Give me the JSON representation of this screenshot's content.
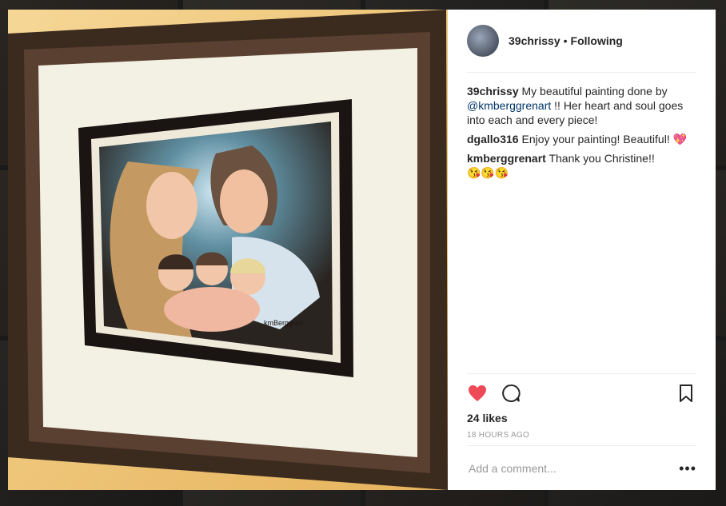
{
  "post": {
    "username": "39chrissy",
    "separator": "•",
    "follow_status": "Following",
    "caption": {
      "user": "39chrissy",
      "text_before": "My beautiful painting done by ",
      "mention": "@kmberggrenart",
      "text_after": " !! Her heart and soul goes into each and every piece!"
    },
    "comments": [
      {
        "user": "dgallo316",
        "text": "Enjoy your painting! Beautiful! ",
        "emoji": "💖"
      },
      {
        "user": "kmberggrenart",
        "text": "Thank you Christine!!",
        "emoji": "😘😘😘"
      }
    ],
    "likes": "24 likes",
    "timestamp": "18 HOURS AGO",
    "add_comment_placeholder": "Add a comment...",
    "more_label": "•••"
  },
  "photo": {
    "signature": "kmBerggren",
    "description_alt": "Framed painting"
  },
  "colors": {
    "heart": "#ed4956",
    "frame": "#3b2a1e",
    "mat": "#f3f0e4",
    "wall": "#f1c879"
  },
  "icons": [
    "heart-icon",
    "comment-icon",
    "bookmark-icon",
    "more-icon"
  ]
}
